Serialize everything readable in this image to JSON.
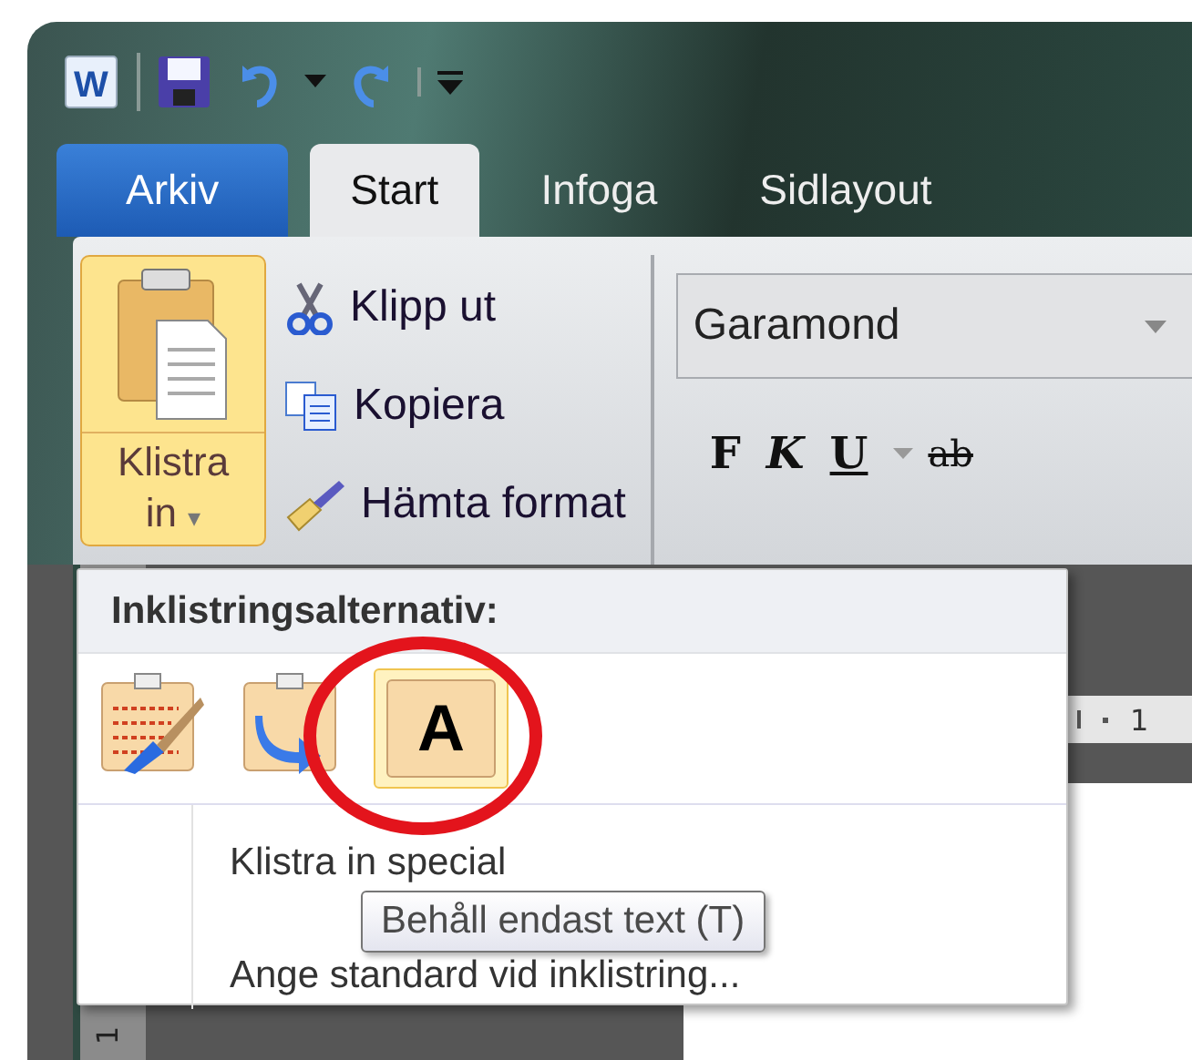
{
  "quick_access": [
    {
      "kind": "word",
      "label": "W"
    },
    {
      "kind": "save"
    },
    {
      "kind": "undo"
    },
    {
      "kind": "dropdown"
    },
    {
      "kind": "redo"
    },
    {
      "kind": "customize"
    }
  ],
  "tabs": [
    {
      "label": "Arkiv",
      "kind": "file",
      "selected": false
    },
    {
      "label": "Start",
      "kind": "tab",
      "selected": true
    },
    {
      "label": "Infoga",
      "kind": "tab",
      "selected": false
    },
    {
      "label": "Sidlayout",
      "kind": "tab",
      "selected": false
    }
  ],
  "clipboard": {
    "paste_button": {
      "label_lines": [
        "Klistra",
        "in"
      ],
      "caret": "▾",
      "highlighted": true
    },
    "items": [
      {
        "label": "Klipp ut",
        "kind": "cut"
      },
      {
        "label": "Kopiera",
        "kind": "copy"
      },
      {
        "label": "Hämta format",
        "kind": "format-painter"
      }
    ]
  },
  "font": {
    "font_name": "Garamond",
    "format_buttons": [
      {
        "label": "F",
        "kind": "bold"
      },
      {
        "label": "K",
        "kind": "italic"
      },
      {
        "label": "U",
        "kind": "underline"
      },
      {
        "label": "ab",
        "kind": "strike"
      }
    ]
  },
  "ruler": {
    "horizontal_label": "1",
    "vertical_label": "1"
  },
  "paste_menu": {
    "heading": "Inklistringsalternativ:",
    "options": [
      {
        "kind": "keep-formatting",
        "selected": false
      },
      {
        "kind": "merge-formatting",
        "selected": false
      },
      {
        "kind": "text-only",
        "label": "A",
        "selected": true
      }
    ],
    "items": [
      "Klistra in special",
      "Ange standard vid inklistring..."
    ],
    "tooltip": "Behåll endast text (T)"
  },
  "annotation": {
    "kind": "circle",
    "color": "#e3141c"
  }
}
